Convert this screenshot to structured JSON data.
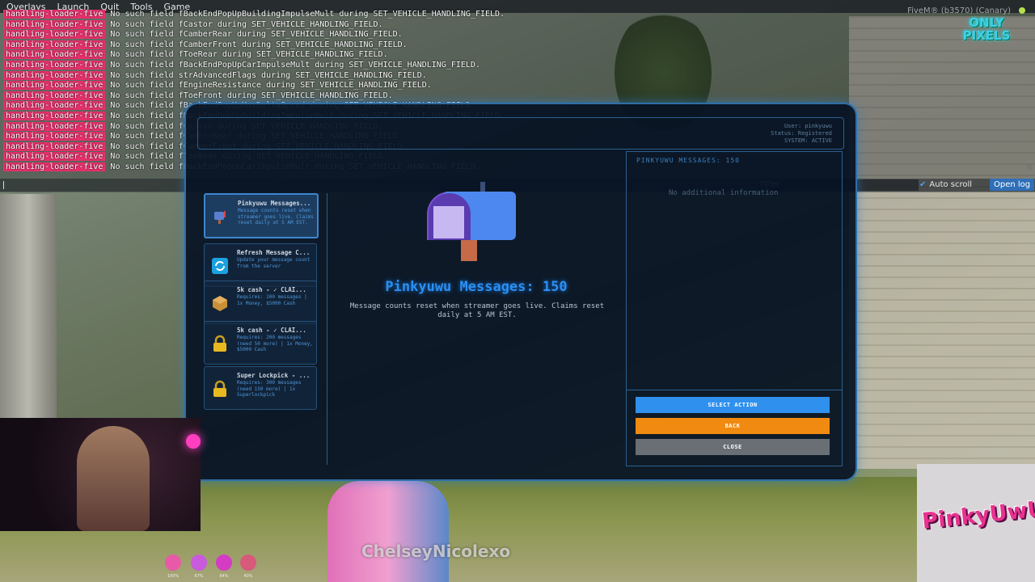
{
  "menubar": {
    "items": [
      "Overlays",
      "Launch",
      "Quit",
      "Tools",
      "Game"
    ],
    "build": "FiveM® (b3570) (Canary)"
  },
  "brand": {
    "logo_text": "ONLY PIXELS"
  },
  "console": {
    "tag": "handling-loader-five",
    "lines": [
      "No such field fBackEndPopUpBuildingImpulseMult during SET_VEHICLE_HANDLING_FIELD.",
      "No such field fCastor during SET_VEHICLE_HANDLING_FIELD.",
      "No such field fCamberRear during SET_VEHICLE_HANDLING_FIELD.",
      "No such field fCamberFront during SET_VEHICLE_HANDLING_FIELD.",
      "No such field fToeRear during SET_VEHICLE_HANDLING_FIELD.",
      "No such field fBackEndPopUpCarImpulseMult during SET_VEHICLE_HANDLING_FIELD.",
      "No such field strAdvancedFlags during SET_VEHICLE_HANDLING_FIELD.",
      "No such field fEngineResistance during SET_VEHICLE_HANDLING_FIELD.",
      "No such field fToeFront during SET_VEHICLE_HANDLING_FIELD.",
      "No such field fBackEndPopUpMaxDeltaSpeed during SET_VEHICLE_HANDLING_FIELD.",
      "No such field fBackEndPopUpBuildingImpulseMult during SET_VEHICLE_HANDLING_FIELD.",
      "No such field fCastor during SET_VEHICLE_HANDLING_FIELD.",
      "No such field fCamberRear during SET_VEHICLE_HANDLING_FIELD.",
      "No such field fCamberFront during SET_VEHICLE_HANDLING_FIELD.",
      "No such field fToeRear during SET_VEHICLE_HANDLING_FIELD.",
      "No such field fBackEndPopUpCarImpulseMult during SET_VEHICLE_HANDLING_FIELD."
    ],
    "filter_placeholder": "Filter",
    "autoscroll_label": "Auto scroll",
    "openlog_label": "Open log"
  },
  "panel": {
    "user_info": [
      "User: pinkyuwu",
      "Status: Registered",
      "SYSTEM: ACTIVE"
    ],
    "right_title": "PINKYUWU MESSAGES: 150",
    "right_subtitle": "No additional information",
    "menu": [
      {
        "title": "Pinkyuwu Messages...",
        "desc": "Message counts reset when streamer goes live. Claims reset daily at 5 AM EST.",
        "icon": "mailbox-icon"
      },
      {
        "title": "Refresh Message C...",
        "desc": "Update your message count from the server",
        "icon": "refresh-icon"
      },
      {
        "title": "5k cash - ✓ CLAI...",
        "desc": "Requires: 100 messages | 1x Money, $5000 Cash",
        "icon": "box-icon"
      },
      {
        "title": "5k cash - ✓ CLAI...",
        "desc": "Requires: 200 messages (need 50 more) | 1x Money, $5000 Cash",
        "icon": "lock-icon"
      },
      {
        "title": "Super Lockpick - ...",
        "desc": "Requires: 300 messages (need 150 more) | 1x Superlockpick",
        "icon": "lock-icon"
      }
    ],
    "main_title": "Pinkyuwu Messages: 150",
    "main_subtitle": "Message counts reset when streamer goes live. Claims reset daily at 5 AM EST.",
    "buttons": {
      "select": "SELECT ACTION",
      "back": "BACK",
      "close": "CLOSE"
    }
  },
  "stream": {
    "name": "ChelseyNicolexo",
    "overlay_logo": "PinkyUwU"
  },
  "hud": [
    {
      "icon": "stamina-icon",
      "value": "100%",
      "color": "#e85aa8"
    },
    {
      "icon": "thirst-icon",
      "value": "67%",
      "color": "#c85adc"
    },
    {
      "icon": "hunger-icon",
      "value": "64%",
      "color": "#d43cc4"
    },
    {
      "icon": "armor-icon",
      "value": "40%",
      "color": "#d85a7a"
    }
  ]
}
